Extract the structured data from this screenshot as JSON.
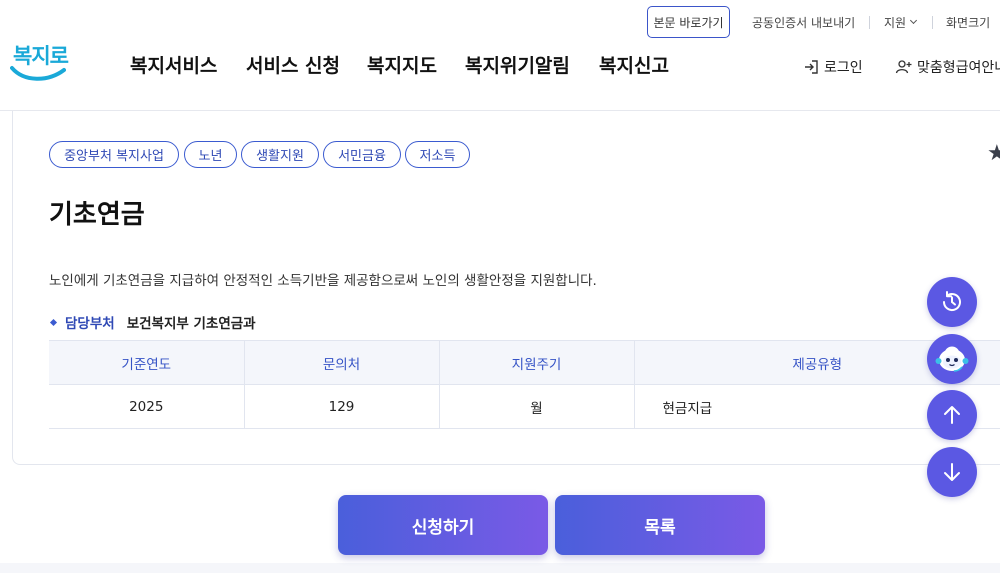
{
  "utility": {
    "skip_link": "본문 바로가기",
    "cert_export": "공동인증서 내보내기",
    "support": "지원",
    "screen_size": "화면크기"
  },
  "header": {
    "logo_text": "복지로",
    "nav": [
      "복지서비스",
      "서비스 신청",
      "복지지도",
      "복지위기알림",
      "복지신고"
    ],
    "login": "로그인",
    "custom_guide": "맞춤형급여안내"
  },
  "service": {
    "tags": [
      "중앙부처 복지사업",
      "노년",
      "생활지원",
      "서민금융",
      "저소득"
    ],
    "title": "기초연금",
    "description": "노인에게 기초연금을 지급하여 안정적인 소득기반을 제공함으로써 노인의 생활안정을 지원합니다.",
    "dept_label": "담당부처",
    "dept_value": "보건복지부 기초연금과",
    "table": {
      "headers": [
        "기준연도",
        "문의처",
        "지원주기",
        "제공유형"
      ],
      "row": [
        "2025",
        "129",
        "월",
        "현금지급"
      ]
    }
  },
  "floating": {
    "icons": [
      "history-icon",
      "chatbot-icon",
      "arrow-up-icon",
      "arrow-down-icon"
    ]
  },
  "actions": {
    "apply": "신청하기",
    "list": "목록"
  },
  "colors": {
    "accent": "#3b5bd0",
    "logo": "#1aa9d8",
    "fab": "#5b58e3",
    "button_gradient_start": "#4a5fdb",
    "button_gradient_end": "#7a5ae6"
  }
}
